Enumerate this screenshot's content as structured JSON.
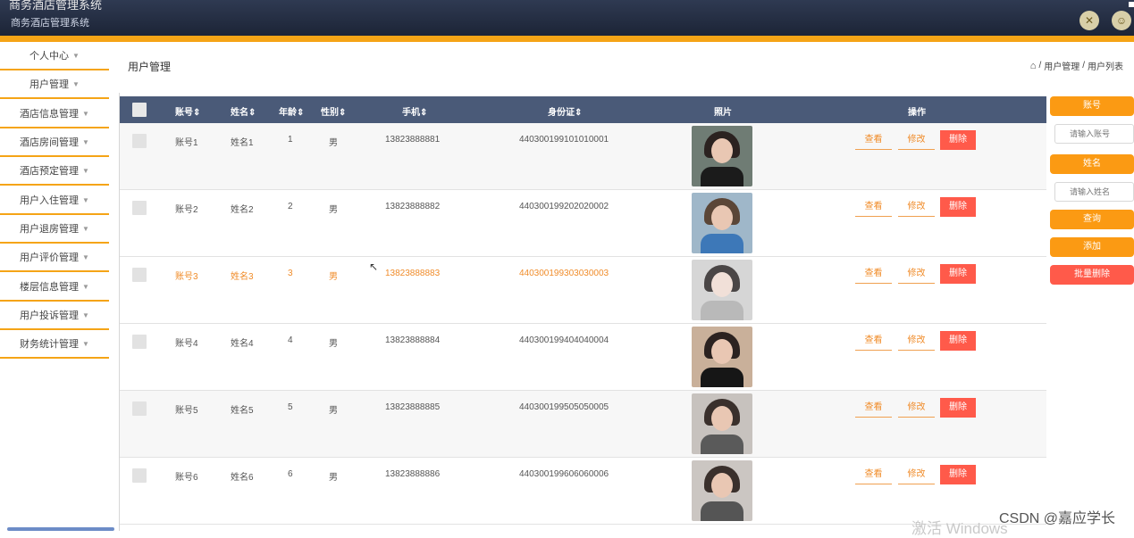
{
  "header": {
    "system_title": "商务酒店管理系统",
    "system_subtitle": "商务酒店管理系统",
    "icons": [
      "settings-icon",
      "user-avatar-icon"
    ]
  },
  "sidebar": {
    "items": [
      {
        "label": "个人中心"
      },
      {
        "label": "用户管理"
      },
      {
        "label": "酒店信息管理"
      },
      {
        "label": "酒店房间管理"
      },
      {
        "label": "酒店预定管理"
      },
      {
        "label": "用户入住管理"
      },
      {
        "label": "用户退房管理"
      },
      {
        "label": "用户评价管理"
      },
      {
        "label": "楼层信息管理"
      },
      {
        "label": "用户投诉管理"
      },
      {
        "label": "财务统计管理"
      }
    ]
  },
  "page": {
    "title": "用户管理",
    "breadcrumb": [
      "用户管理",
      "用户列表"
    ],
    "breadcrumb_sep": "/"
  },
  "table": {
    "headers": [
      "账号",
      "姓名",
      "年龄",
      "性别",
      "手机",
      "身份证",
      "照片",
      "操作"
    ],
    "sort_mark": "⇕",
    "rows": [
      {
        "account": "账号1",
        "name": "姓名1",
        "age": "1",
        "gender": "男",
        "phone": "13823888881",
        "id_card": "440300199101010001"
      },
      {
        "account": "账号2",
        "name": "姓名2",
        "age": "2",
        "gender": "男",
        "phone": "13823888882",
        "id_card": "440300199202020002"
      },
      {
        "account": "账号3",
        "name": "姓名3",
        "age": "3",
        "gender": "男",
        "phone": "13823888883",
        "id_card": "440300199303030003"
      },
      {
        "account": "账号4",
        "name": "姓名4",
        "age": "4",
        "gender": "男",
        "phone": "13823888884",
        "id_card": "440300199404040004"
      },
      {
        "account": "账号5",
        "name": "姓名5",
        "age": "5",
        "gender": "男",
        "phone": "13823888885",
        "id_card": "440300199505050005"
      },
      {
        "account": "账号6",
        "name": "姓名6",
        "age": "6",
        "gender": "男",
        "phone": "13823888886",
        "id_card": "440300199606060006"
      }
    ],
    "actions": {
      "view": "查看",
      "edit": "修改",
      "delete": "删除"
    }
  },
  "search_panel": {
    "account_label": "账号",
    "account_placeholder": "请输入账号",
    "name_label": "姓名",
    "name_placeholder": "请输入姓名",
    "query_button": "查询",
    "add_button": "添加",
    "batch_delete_button": "批量删除"
  },
  "watermarks": {
    "windows": "激活 Windows",
    "csdn": "CSDN @嘉应学长"
  },
  "colors": {
    "accent_orange": "#f5a416",
    "header_bg": "#1c2436",
    "table_header_bg": "#4a5a78",
    "delete_red": "#ff5a4a"
  }
}
